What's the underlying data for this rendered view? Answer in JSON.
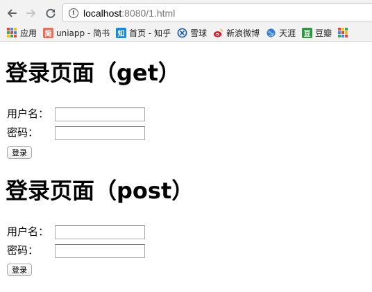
{
  "browser": {
    "url_host": "localhost",
    "url_rest": ":8080/1.html",
    "bookmarks": [
      {
        "label": "应用",
        "icon": "apps-grid-icon",
        "color": "#4285f4"
      },
      {
        "label": "uniapp - 简书",
        "icon": "jianshu-icon",
        "glyph": "简",
        "color": "#ea6f5a"
      },
      {
        "label": "首页 - 知乎",
        "icon": "zhihu-icon",
        "glyph": "知",
        "color": "#0f88eb"
      },
      {
        "label": "雪球",
        "icon": "xueqiu-icon",
        "color": "#1a5fb4"
      },
      {
        "label": "新浪微博",
        "icon": "weibo-icon",
        "color": "#e6162d"
      },
      {
        "label": "天涯",
        "icon": "tianya-globe-icon",
        "color": "#3a7bd5"
      },
      {
        "label": "豆瓣",
        "icon": "douban-icon",
        "glyph": "豆",
        "color": "#2e963d"
      }
    ]
  },
  "forms": [
    {
      "title": "登录页面（get）",
      "username_label": "用户名：",
      "username_value": "",
      "password_label": "密码：",
      "password_value": "",
      "submit_label": "登录"
    },
    {
      "title": "登录页面（post）",
      "username_label": "用户名：",
      "username_value": "",
      "password_label": "密码：",
      "password_value": "",
      "submit_label": "登录"
    }
  ]
}
